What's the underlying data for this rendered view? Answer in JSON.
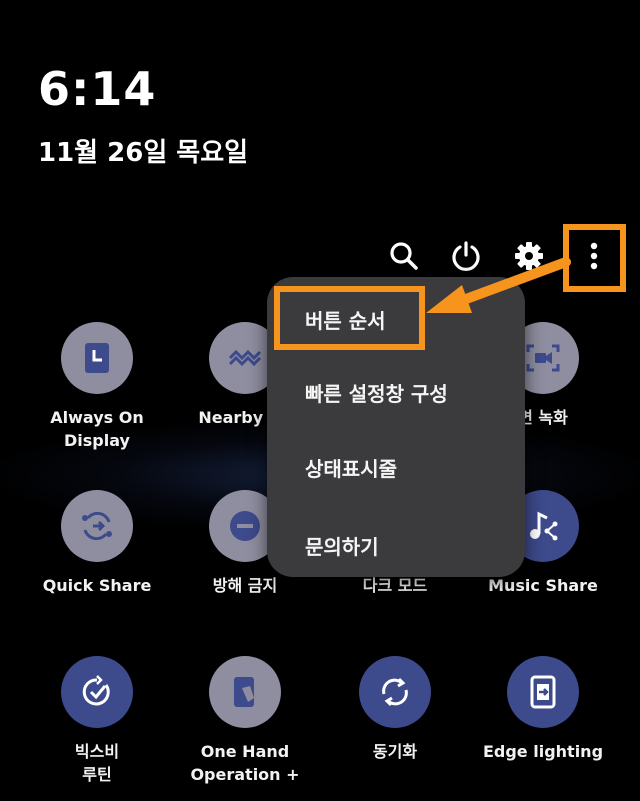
{
  "lockscreen": {
    "time": "6:14",
    "date": "11월 26일 목요일"
  },
  "top_icons": [
    "search-icon",
    "power-icon",
    "gear-icon",
    "more-vert-icon"
  ],
  "tiles": [
    {
      "label": "Always On\nDisplay",
      "state": "off",
      "icon": "clock-icon"
    },
    {
      "label": "Nearby Sh",
      "state": "off",
      "icon": "nearby-icon"
    },
    {
      "label": "",
      "state": "off",
      "icon": "hidden"
    },
    {
      "label": "면 녹화",
      "state": "off",
      "icon": "screen-record-icon"
    },
    {
      "label": "Quick Share",
      "state": "off",
      "icon": "share-icon"
    },
    {
      "label": "방해 금지",
      "state": "off",
      "icon": "minus-icon"
    },
    {
      "label": "다크 모드",
      "state": "off",
      "icon": "hidden"
    },
    {
      "label": "Music Share",
      "state": "on",
      "icon": "music-icon"
    },
    {
      "label": "빅스비\n루틴",
      "state": "on",
      "icon": "routine-icon"
    },
    {
      "label": "One Hand\nOperation +",
      "state": "off",
      "icon": "one-hand-icon"
    },
    {
      "label": "동기화",
      "state": "on",
      "icon": "sync-icon"
    },
    {
      "label": "Edge lighting",
      "state": "on",
      "icon": "edge-icon"
    }
  ],
  "menu": {
    "items": [
      "버튼 순서",
      "빠른 설정창 구성",
      "상태표시줄",
      "문의하기"
    ]
  },
  "colors": {
    "highlight": "#f7941d",
    "tile_on": "#3d4a8c",
    "tile_off": "#8e8ea0",
    "menu_bg": "#3b3b3d"
  }
}
